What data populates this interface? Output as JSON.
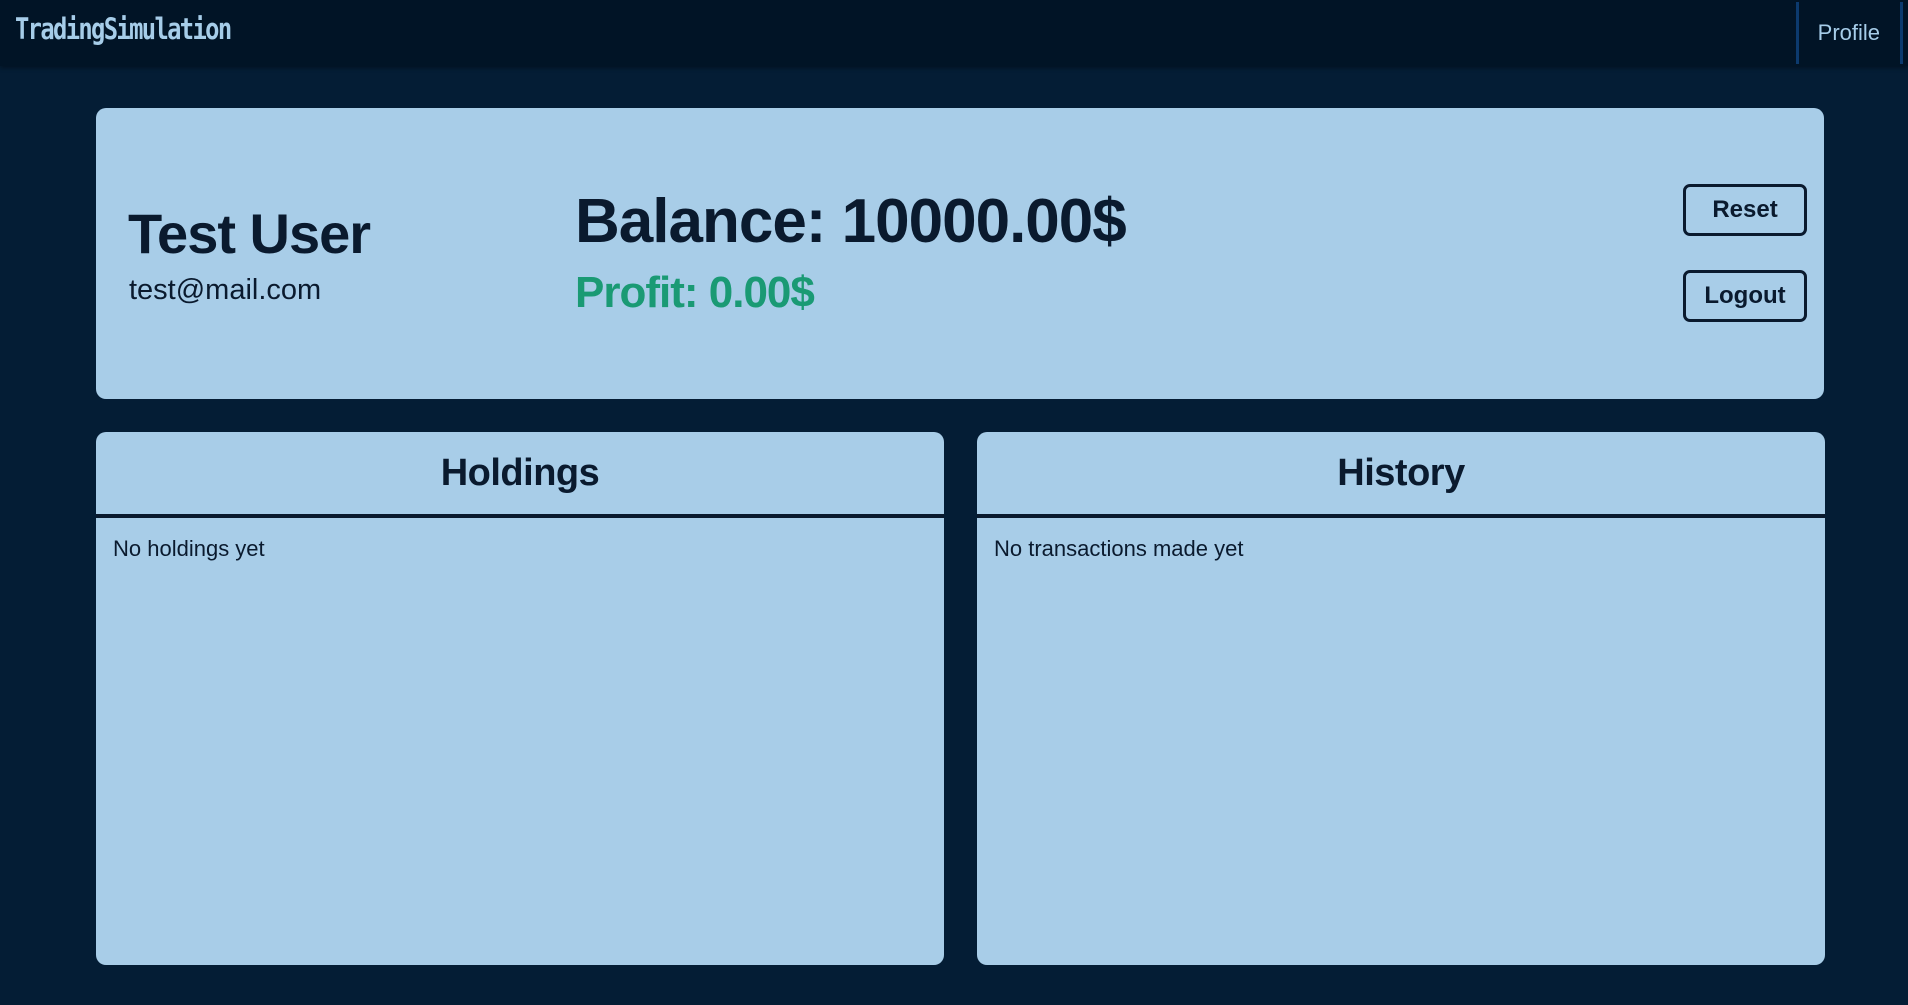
{
  "navbar": {
    "brand": "TradingSimulation",
    "profile_link": "Profile"
  },
  "profile": {
    "name": "Test User",
    "email": "test@mail.com",
    "balance": "Balance: 10000.00$",
    "profit": "Profit: 0.00$",
    "reset_label": "Reset",
    "logout_label": "Logout"
  },
  "holdings": {
    "title": "Holdings",
    "empty_text": "No holdings yet"
  },
  "history": {
    "title": "History",
    "empty_text": "No transactions made yet"
  },
  "colors": {
    "background": "#041d35",
    "navbar": "#011426",
    "card": "#a8cde8",
    "text": "#0a1a2e",
    "profit": "#1a9a74",
    "brand": "#a6cde9"
  }
}
